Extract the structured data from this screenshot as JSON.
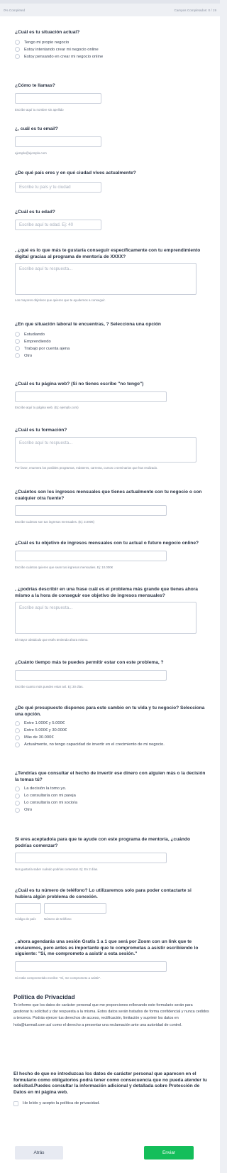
{
  "progress": {
    "completed_label": "0% Completed",
    "fields_label": "Campos Completados: 0 / 19"
  },
  "q1": {
    "title": "¿Cuál es tu situación actual?",
    "options": [
      "Tengo mi propio negocio",
      "Estoy intentando crear mi negocio online",
      "Estoy pensando en crear mi negocio online"
    ]
  },
  "q2": {
    "title": "¿Cómo te llamas?",
    "hint": "Escribe aquí tu nombre sin apellido"
  },
  "q3": {
    "title": "¿, cuál es tu email?",
    "hint": "ejemplo@ejemplo.com"
  },
  "q4": {
    "title": "¿De qué país eres y en qué ciudad vives actualmente?",
    "placeholder": "Escribe tu país y tu ciudad"
  },
  "q5": {
    "title": "¿Cuál es tu edad?",
    "placeholder": "Escribe aquí tu edad. Ej: 40"
  },
  "q6": {
    "title": ", ¿qué es lo que más te gustaría conseguir específicamente con tu emprendimiento digital gracias al programa de mentoría de XXXX?",
    "placeholder": "Escribe aquí tu respuesta...",
    "hint": "Los mayores objetivos que quieres que te ayudemos a conseguir."
  },
  "q7": {
    "title": "¿En que situación laboral te encuentras, ? Selecciona una opción",
    "options": [
      "Estudiando",
      "Emprendiendo",
      "Trabajo por cuenta ajena",
      "Otro"
    ]
  },
  "q8": {
    "title": "¿Cuál es tu página web? (Si no tienes escribe \"no tengo\")",
    "hint": "Escribe aquí tu página web. (Ej: ejemplo.com)"
  },
  "q9": {
    "title": "¿Cuál es tu formación?",
    "placeholder": "Escribe aquí tu respuesta...",
    "hint": "Por favor, enumera los posibles programas, másteres, carreras, cursos o seminarios que has realizado."
  },
  "q10": {
    "title": "¿Cuántos son los ingresos mensuales que tienes actualmente con tu negocio o con cualquier otra fuente?",
    "hint": "Escribe cuántos son tus ingresos mensuales. (Ej: 3.000€)"
  },
  "q11": {
    "title": "¿Cuál es tu objetivo de ingresos mensuales con tu actual o futuro negocio online?",
    "hint": "Escribe cuántos quieres que sean tus ingresos mensuales. Ej: 10.000€"
  },
  "q12": {
    "title": ", ¿podrías describir en una frase cuál es el problema más grande que tienes ahora mismo a la hora de conseguir ese objetivo de ingresos mensuales?",
    "placeholder": "Escribe aquí tu respuesta...",
    "hint": "El mayor obstáculo que estés teniendo ahora mismo."
  },
  "q13": {
    "title": "¿Cuánto tiempo más te puedes permitir estar con este problema, ?",
    "hint": "Escribe cuanto más puedes estar así. Ej: 30 días."
  },
  "q14": {
    "title": "¿De qué presupuesto dispones para este cambio en tu vida y tu negocio? Selecciona una opción.",
    "options": [
      "Entre 1.000€ y 5.000€",
      "Entre 5.000€ y 30.000€",
      "Más de 30.000€",
      "Actualmente, no tengo capacidad de invertir en el crecimiento de mi negocio."
    ]
  },
  "q15": {
    "title": "¿Tendrías que consultar el hecho de invertir ese dinero con alguien más o la decisión la tomas tú?",
    "options": [
      "La decisión la tomo yo.",
      "Lo consultaría con mi pareja",
      "Lo consultaría con mi socio/a",
      "Otro"
    ]
  },
  "q16": {
    "title": "Si eres aceptado/a para que te ayude con este programa de mentoría, ¿cuándo podrías comenzar?",
    "hint": "Nos gustaría saber cuándo podrías comenzar. Ej: En 2 días."
  },
  "q17": {
    "title": "¿Cuál es tu número de teléfono? Lo utilizaremos solo para poder contactarte si hubiera algún problema de conexión.",
    "hint_code": "Código de país",
    "hint_number": "Número de teléfono"
  },
  "q18": {
    "title": ", ahora agendarás una sesión Gratis 1 a 1 que será por Zoom con un link que te enviaremos, pero antes es importante que te comprometas a asistir escribiendo lo siguiente: \"Sí, me comprometo a asistir a esta sesión.\"",
    "hint": "Si estás comprometido escribe: \"Sí, me comprometo a asistir\"."
  },
  "privacy": {
    "title": "Política de Privacidad",
    "text": "Te informo que los datos de carácter personal que me proporciones rellenando este formulario serán para gestionar tu solicitud y dar respuesta a la misma.  Estos datos serán tratados de forma confidencial y nunca cedidos a terceros. Podrás ejercer tus derechos de acceso, rectificación, limitación y suprimir los datos en hola@tuemail.com así como el derecho a presentar una reclamación ante una autoridad de control.",
    "notice": "El hecho de que no introduzcas los datos de carácter personal que aparecen en el formulario como obligatorios podrá tener como consecuencia que no pueda atender tu solicitud.Puedes consultar la información adicional y detallada sobre Protección de Datos en mi página web.",
    "checkbox_label": "He leído y acepto la política de privacidad."
  },
  "buttons": {
    "back": "Atrás",
    "submit": "Enviar"
  }
}
